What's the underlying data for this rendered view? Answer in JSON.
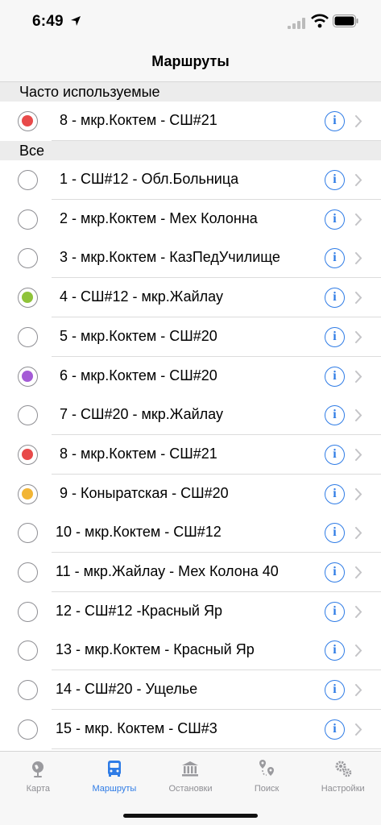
{
  "status": {
    "time": "6:49"
  },
  "nav": {
    "title": "Маршруты"
  },
  "sections": {
    "favorites": "Часто используемые",
    "all": "Все"
  },
  "favorites": [
    {
      "label": "8 - мкр.Коктем - СШ#21",
      "color": "#e84a4a"
    }
  ],
  "routes": [
    {
      "label": "1 - СШ#12 - Обл.Больница",
      "color": null
    },
    {
      "label": "2 - мкр.Коктем - Мех Колонна",
      "color": null
    },
    {
      "label": "3 - мкр.Коктем - КазПедУчилище",
      "color": null
    },
    {
      "label": "4 - СШ#12 - мкр.Жайлау",
      "color": "#8fc33a"
    },
    {
      "label": "5 - мкр.Коктем - СШ#20",
      "color": null
    },
    {
      "label": "6 - мкр.Коктем - СШ#20",
      "color": "#a45bd6"
    },
    {
      "label": "7 - СШ#20 - мкр.Жайлау",
      "color": null
    },
    {
      "label": "8 - мкр.Коктем - СШ#21",
      "color": "#e84a4a"
    },
    {
      "label": "9 - Коныратская - СШ#20",
      "color": "#f2b535"
    },
    {
      "label": "10 - мкр.Коктем - СШ#12",
      "color": null
    },
    {
      "label": "11 - мкр.Жайлау - Мех Колона 40",
      "color": null
    },
    {
      "label": "12 - СШ#12 -Красный Яр",
      "color": null
    },
    {
      "label": "13 - мкр.Коктем - Красный Яр",
      "color": null
    },
    {
      "label": "14 - СШ#20 - Ущелье",
      "color": null
    },
    {
      "label": "15 - мкр. Коктем - СШ#3",
      "color": null
    }
  ],
  "info_glyph": "i",
  "tabs": [
    {
      "label": "Карта",
      "icon": "globe-icon",
      "active": false
    },
    {
      "label": "Маршруты",
      "icon": "bus-icon",
      "active": true
    },
    {
      "label": "Остановки",
      "icon": "bank-icon",
      "active": false
    },
    {
      "label": "Поиск",
      "icon": "route-pin-icon",
      "active": false
    },
    {
      "label": "Настройки",
      "icon": "gears-icon",
      "active": false
    }
  ],
  "colors": {
    "accent": "#2f7ce6",
    "inactive": "#8e8e93"
  }
}
